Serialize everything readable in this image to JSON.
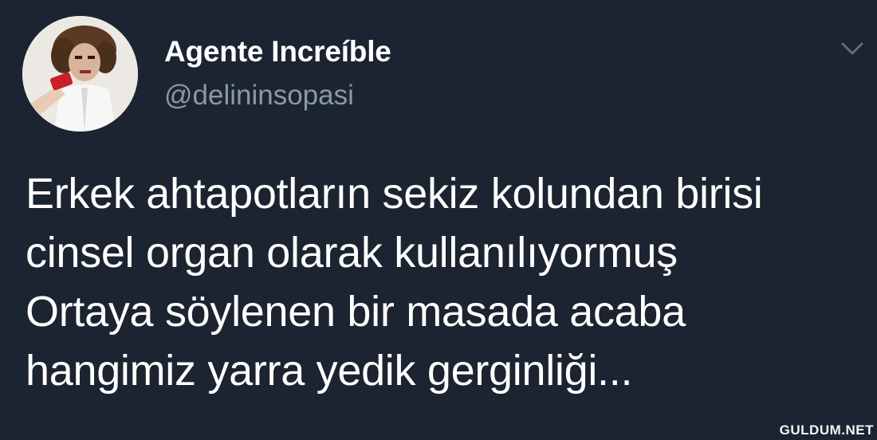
{
  "tweet": {
    "author": {
      "display_name": "Agente Increíble",
      "handle": "@delininsopasi",
      "avatar_icon": "profile-avatar"
    },
    "menu_icon": "chevron-down-icon",
    "text_lines": [
      "Erkek ahtapotların sekiz kolundan birisi",
      "cinsel organ olarak kullanılıyormuş",
      "Ortaya söylenen bir masada acaba",
      "hangimiz yarra yedik gerginliği..."
    ]
  },
  "watermark": "GULDUM.NET",
  "colors": {
    "background": "#1b2430",
    "primary_text": "#ffffff",
    "secondary_text": "#8899a6"
  }
}
